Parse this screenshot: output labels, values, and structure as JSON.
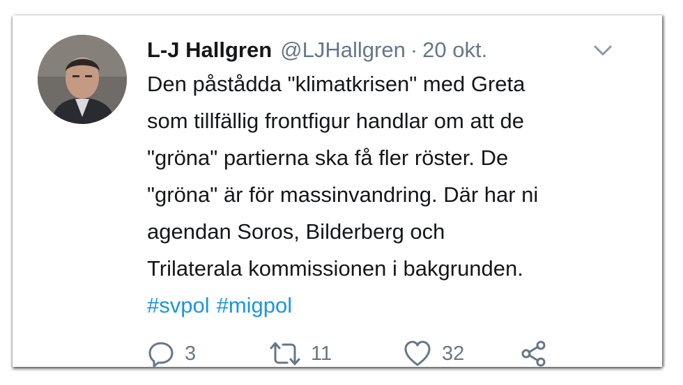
{
  "tweet": {
    "author_name": "L-J Hallgren",
    "handle": "@LJHallgren",
    "separator": "·",
    "date": "20 okt.",
    "lines": [
      "Den påstådda \"klimatkrisen\" med Greta",
      "som tillfällig frontfigur handlar om att de",
      "\"gröna\" partierna ska få fler röster. De",
      "\"gröna\" är för massinvandring. Där har ni",
      "agendan Soros, Bilderberg och",
      "Trilaterala kommissionen i bakgrunden."
    ],
    "hashtags": [
      "#svpol",
      "#migpol"
    ]
  },
  "actions": {
    "reply_count": "3",
    "retweet_count": "11",
    "like_count": "32"
  },
  "icons": [
    "chevron-down-icon",
    "reply-icon",
    "retweet-icon",
    "heart-icon",
    "share-icon"
  ],
  "colors": {
    "text": "#14171a",
    "muted": "#657786",
    "link": "#1b95e0"
  }
}
